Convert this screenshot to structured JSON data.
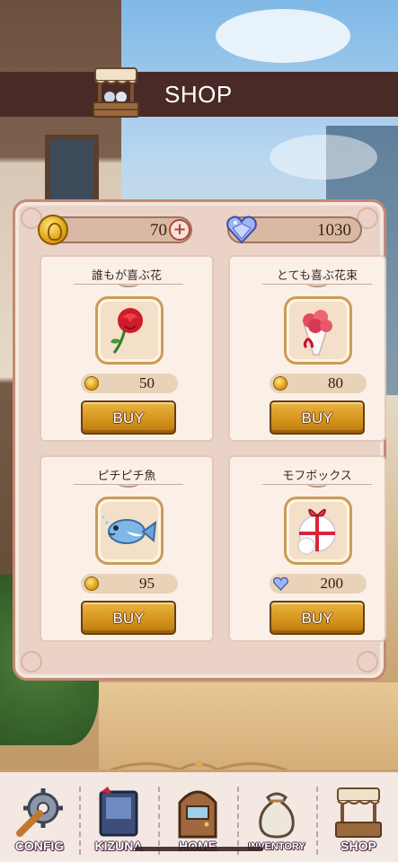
{
  "header": {
    "title": "SHOP",
    "icon": "shop-stall-icon"
  },
  "currency": {
    "coins": {
      "value": "70",
      "icon": "gold-coin-icon",
      "add_icon": "plus-icon"
    },
    "gems": {
      "value": "1030",
      "icon": "blue-heart-gem-icon"
    }
  },
  "items": [
    {
      "name": "誰もが喜ぶ花",
      "icon": "red-rose-icon",
      "price": "50",
      "currency_icon": "gold-coin-icon",
      "buy_label": "BUY"
    },
    {
      "name": "とても喜ぶ花束",
      "icon": "flower-bouquet-icon",
      "price": "80",
      "currency_icon": "gold-coin-icon",
      "buy_label": "BUY"
    },
    {
      "name": "ピチピチ魚",
      "icon": "fish-icon",
      "price": "95",
      "currency_icon": "gold-coin-icon",
      "buy_label": "BUY"
    },
    {
      "name": "モフボックス",
      "icon": "fluffy-gift-box-icon",
      "price": "200",
      "currency_icon": "blue-heart-gem-icon",
      "buy_label": "BUY"
    }
  ],
  "nav": [
    {
      "label": "CONFIG",
      "icon": "gear-wrench-icon"
    },
    {
      "label": "KIZUNA",
      "icon": "book-icon"
    },
    {
      "label": "HOME",
      "icon": "door-icon"
    },
    {
      "label": "INVENTORY",
      "icon": "sack-icon"
    },
    {
      "label": "SHOP",
      "icon": "shop-stall-icon"
    }
  ],
  "colors": {
    "header_bg": "#4a2a26",
    "panel_bg": "#ead2c7",
    "buy_button": "#d6961d",
    "nav_bg": "#f3e8e2"
  }
}
